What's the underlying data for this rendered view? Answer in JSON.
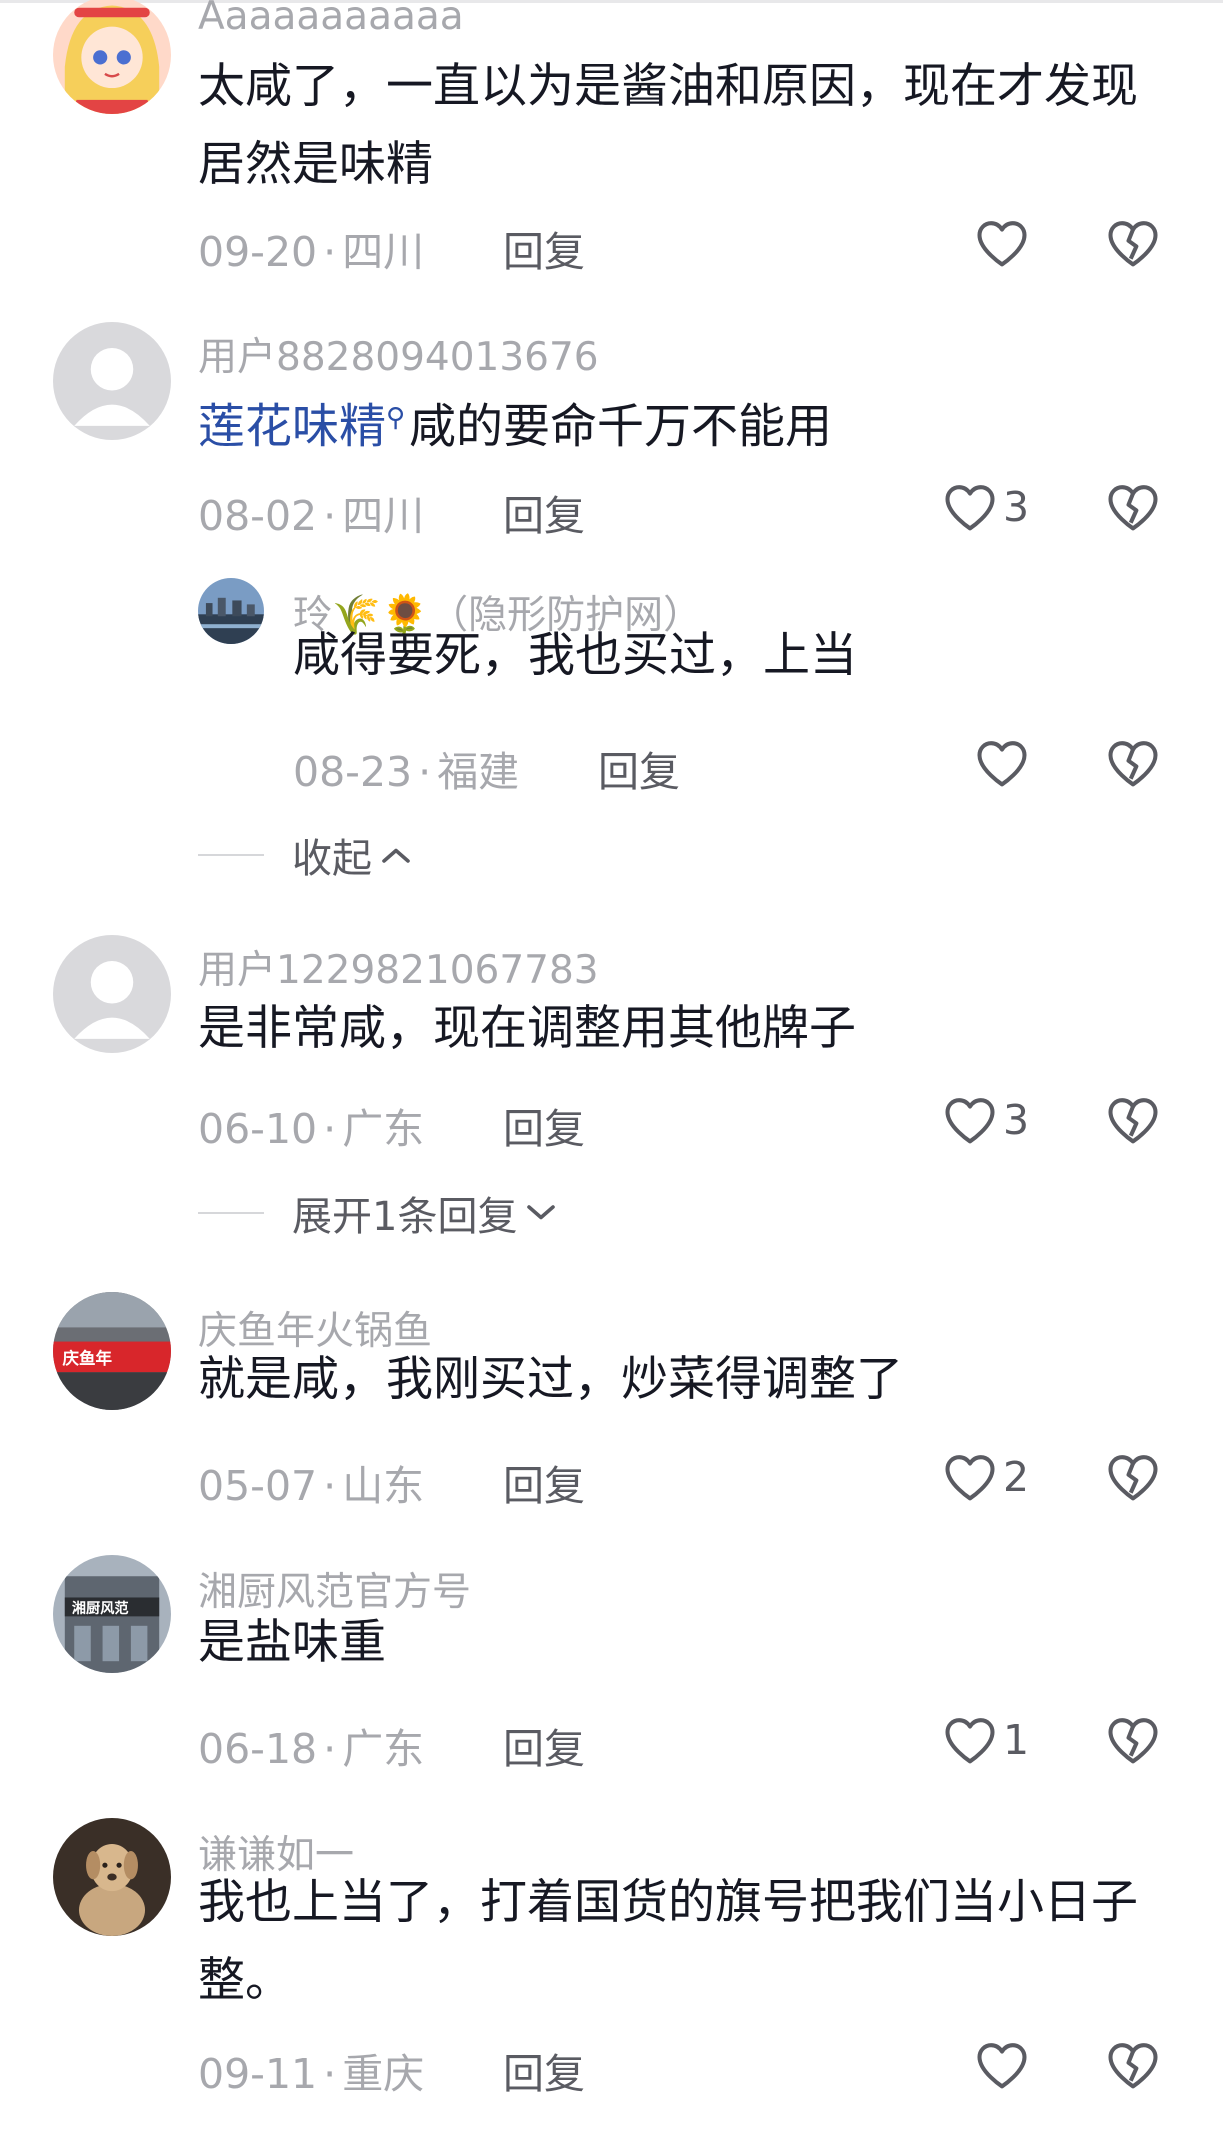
{
  "comments": [
    {
      "username": "Aaaaaaaaaaa",
      "text": "太咸了，一直以为是酱油和原因，现在才发现居然是味精",
      "date": "09-20",
      "location": "四川",
      "reply_label": "回复",
      "likes": ""
    },
    {
      "username": "用户8828094013676",
      "topic": "莲花味精",
      "text": "咸的要命千万不能用",
      "date": "08-02",
      "location": "四川",
      "reply_label": "回复",
      "likes": "3",
      "replies": [
        {
          "username": "玲🌾🌻（隐形防护网）",
          "text": "咸得要死，我也买过，上当",
          "date": "08-23",
          "location": "福建",
          "reply_label": "回复",
          "likes": ""
        }
      ],
      "collapse_label": "收起"
    },
    {
      "username": "用户1229821067783",
      "text": "是非常咸，现在调整用其他牌子",
      "date": "06-10",
      "location": "广东",
      "reply_label": "回复",
      "likes": "3",
      "expand_label": "展开1条回复"
    },
    {
      "username": "庆鱼年火锅鱼",
      "text": "就是咸，我刚买过，炒菜得调整了",
      "date": "05-07",
      "location": "山东",
      "reply_label": "回复",
      "likes": "2",
      "avatar_text": "庆鱼年"
    },
    {
      "username": "湘厨风范官方号",
      "text": "是盐味重",
      "date": "06-18",
      "location": "广东",
      "reply_label": "回复",
      "likes": "1",
      "avatar_text": "湘厨风范"
    },
    {
      "username": "谦谦如一",
      "text": "我也上当了，打着国货的旗号把我们当小日子整。",
      "date": "09-11",
      "location": "重庆",
      "reply_label": "回复",
      "likes": ""
    }
  ],
  "meta_separator": "·",
  "icons": {
    "like": "heart-outline-icon",
    "dislike": "broken-heart-icon",
    "search": "search-icon",
    "chevron_up": "chevron-up-icon",
    "chevron_down": "chevron-down-icon"
  },
  "colors": {
    "text": "#161823",
    "secondary": "#a7a8ad",
    "topic": "#2a4ea6"
  }
}
